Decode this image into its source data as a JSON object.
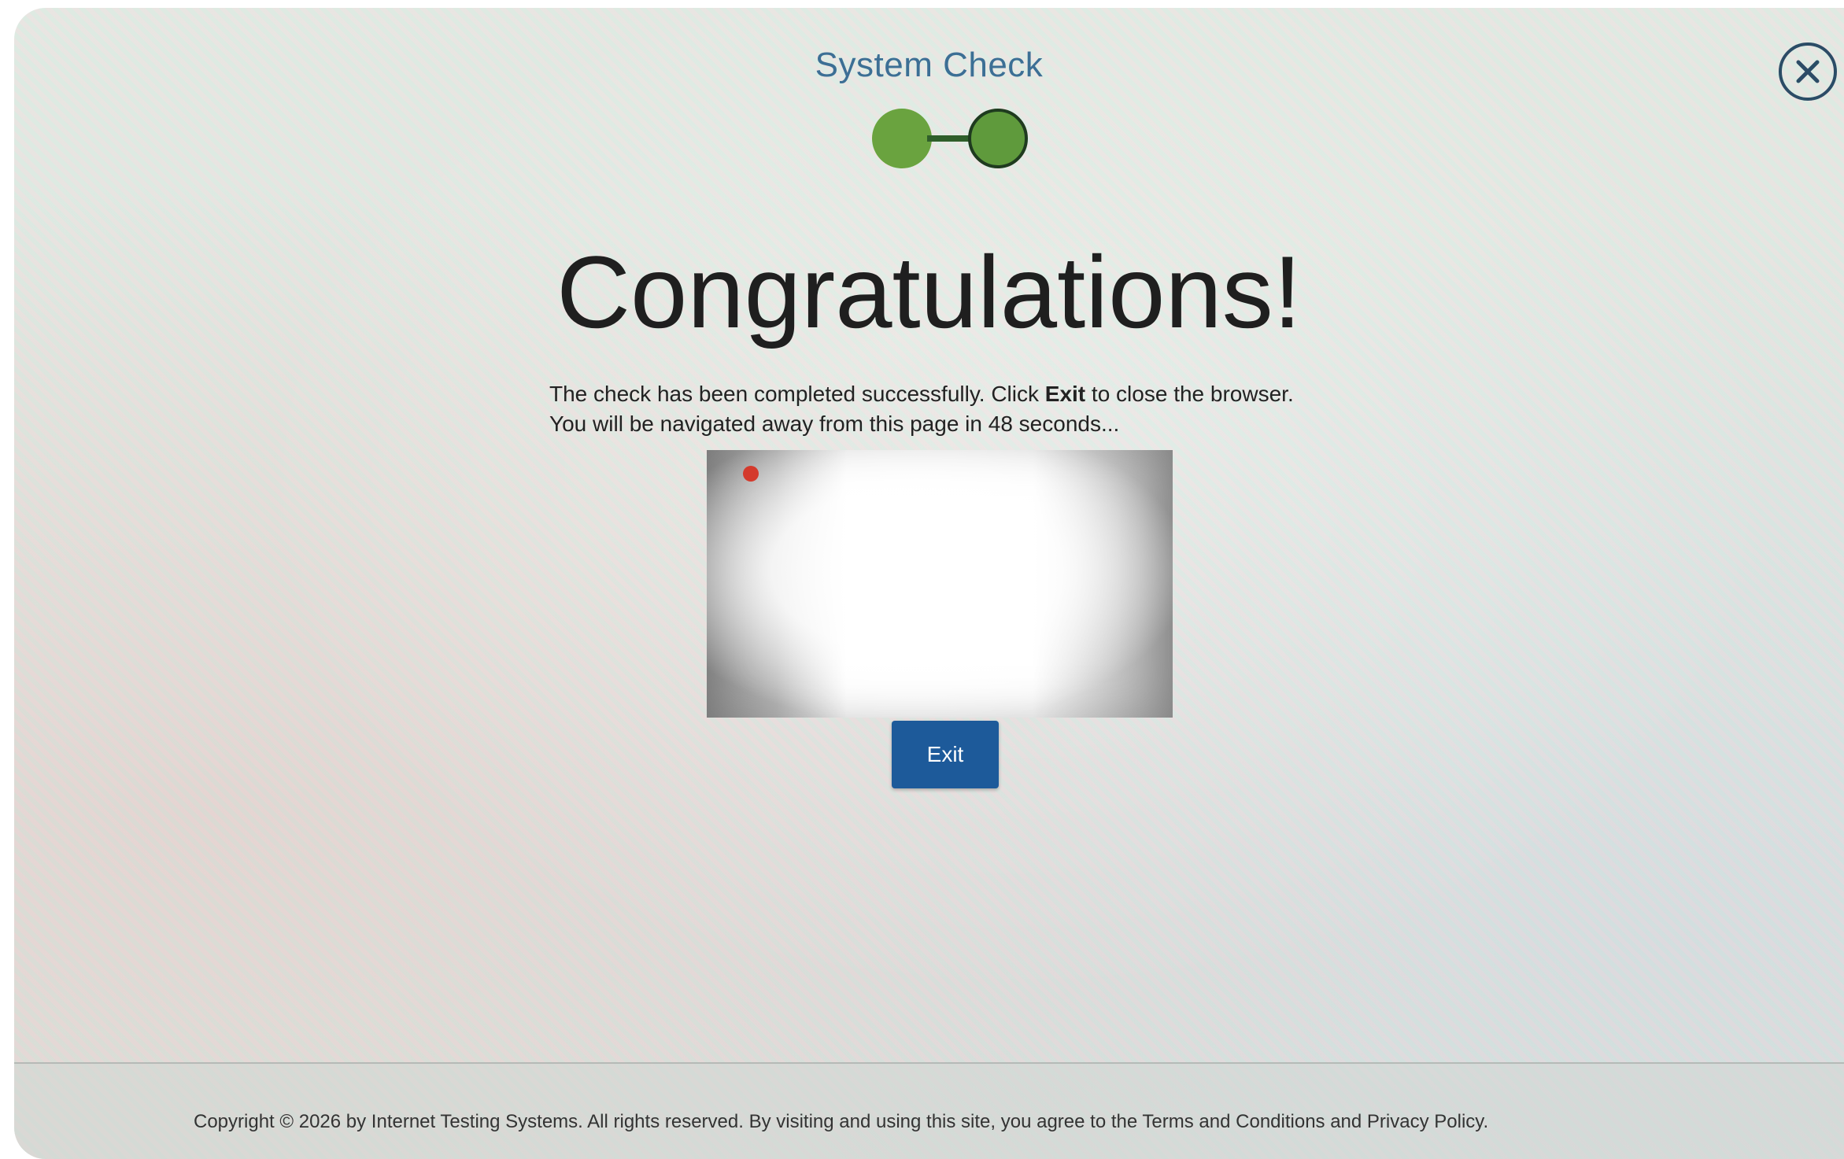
{
  "header": {
    "title": "System Check"
  },
  "stepper": {
    "steps": [
      {
        "state": "complete",
        "color": "#6aa33f"
      },
      {
        "state": "current",
        "color": "#5f9a3c"
      }
    ]
  },
  "close_icon": "close-icon",
  "main": {
    "headline": "Congratulations!",
    "message_part1": "The check has been completed successfully. Click ",
    "message_bold": "Exit",
    "message_part2": " to close the browser.",
    "message_line2": "You will be navigated away from this page in 48 seconds...",
    "exit_label": "Exit"
  },
  "camera": {
    "recording_indicator_color": "#d43a2c"
  },
  "footer": {
    "copyright": "Copyright © 2026 by Internet Testing Systems. All rights reserved. By visiting and using this site, you agree to the Terms and Conditions and Privacy Policy."
  },
  "colors": {
    "accent": "#1d5a9a",
    "title": "#3c6f95",
    "success": "#6aa33f"
  }
}
